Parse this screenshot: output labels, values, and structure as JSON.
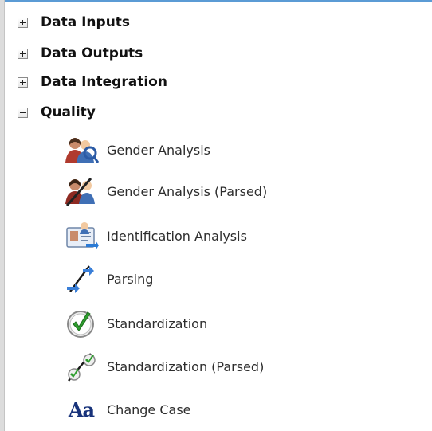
{
  "tree": {
    "groups": [
      {
        "label": "Data Inputs",
        "expander": "+"
      },
      {
        "label": "Data Outputs",
        "expander": "+"
      },
      {
        "label": "Data Integration",
        "expander": "+"
      },
      {
        "label": "Quality",
        "expander": "-"
      }
    ],
    "quality_items": [
      {
        "label": "Gender Analysis",
        "icon": "gender-analysis-icon"
      },
      {
        "label": "Gender Analysis (Parsed)",
        "icon": "gender-analysis-parsed-icon"
      },
      {
        "label": "Identification Analysis",
        "icon": "identification-analysis-icon"
      },
      {
        "label": "Parsing",
        "icon": "parsing-icon"
      },
      {
        "label": "Standardization",
        "icon": "standardization-icon"
      },
      {
        "label": "Standardization (Parsed)",
        "icon": "standardization-parsed-icon"
      },
      {
        "label": "Change Case",
        "icon": "change-case-icon",
        "glyph": "Aa"
      }
    ]
  },
  "colors": {
    "accent_border": "#5b9bd5",
    "check_green": "#2e9e2e",
    "change_case_blue": "#17327a"
  }
}
